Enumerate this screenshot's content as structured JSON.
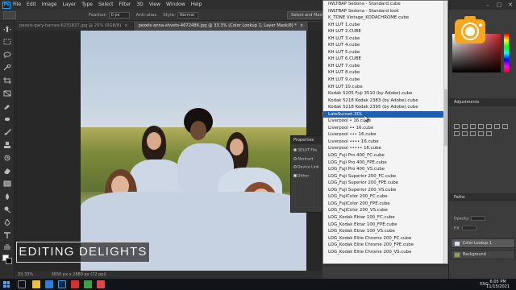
{
  "menubar": {
    "app_icon": "photoshop-logo",
    "items": [
      "File",
      "Edit",
      "Image",
      "Layer",
      "Type",
      "Select",
      "Filter",
      "3D",
      "View",
      "Window",
      "Help"
    ]
  },
  "options": {
    "feather_label": "Feather:",
    "feather_value": "0 px",
    "antialias_label": "Anti-alias",
    "style_label": "Style:",
    "style_value": "Normal",
    "select_mask_label": "Select and Mask..."
  },
  "tabs": [
    {
      "label": "pexels-gary-barnes-6231637.jpg @ 25% (RGB/8)",
      "close": "×"
    },
    {
      "label": "pexels-anna-shvets-4672486.jpg @ 33.3% (Color Lookup 1, Layer Mask/8) *",
      "close": "×"
    }
  ],
  "properties": {
    "title": "Properties",
    "row_file": "3DLUT File",
    "row_abstract": "Abstract",
    "row_device": "Device Link",
    "row_dither": "Dither"
  },
  "lut_list": {
    "items": [
      "IWLTBAP Sedona - Standard.cube",
      "IWLTBAP Sedona - Standard.look",
      "K_TONE Vintage_KODACHROME.cube",
      "KH LUT 1.cube",
      "KH LUT 2.CUBE",
      "KH LUT 3.cube",
      "KH LUT 4.cube",
      "KH LUT 5.cube",
      "KH LUT 6.CUBE",
      "KH LUT 7.cube",
      "KH LUT 8.cube",
      "KH LUT 9.cube",
      "KH LUT 10.cube",
      "Kodak 5205 Fuji 3510 (by Adobe).cube",
      "Kodak 5218 Kodak 2383 (by Adobe).cube",
      "Kodak 5218 Kodak 2395 (by Adobe).cube",
      "LateSunset.3DL",
      "Liverpool • 16.cube",
      "Liverpool •• 16.cube",
      "Liverpool ••• 16.cube",
      "Liverpool •••• 16.cube",
      "Liverpool ••••• 16.cube",
      "LOG_Fuji Pro 400_FC.cube",
      "LOG_Fuji Pro 400_FPE.cube",
      "LOG_Fuji Pro 400_VS.cube",
      "LOG_Fuji Superior 200_FC.cube",
      "LOG_Fuji Superior 200_FPE.cube",
      "LOG_Fuji Superior 200_VS.cube",
      "LOG_FujiColor 200_FC.cube",
      "LOG_FujiColor 200_FPE.cube",
      "LOG_FujiColor 200_VS.cube",
      "LOG_Kodak Ektar 100_FC.cube",
      "LOG_Kodak Ektar 100_FPE.cube",
      "LOG_Kodak Ektar 100_VS.cube",
      "LOG_Kodak Elite Chrome 200_FC.cube",
      "LOG_Kodak Elite Chrome 200_FPE.cube",
      "LOG_Kodak Elite Chrome 200_VS.cube"
    ],
    "selected_index": 16
  },
  "right_panel": {
    "adjustments_title": "Adjustments",
    "paths_title": "Paths",
    "opacity_label": "Opacity:",
    "fill_label": "Fill:",
    "layer_selected": "Color Lookup 1",
    "layer_base": "Background"
  },
  "status": {
    "zoom": "33.33%",
    "doc": "3650 px x 2880 px (72 ppi)"
  },
  "taskbar": {
    "tray_lang": "ENG",
    "time": "6:05 PM",
    "date": "11/15/2021"
  },
  "watermark": {
    "text": "EDITING DELIGHTS",
    "logo": "camera-icon"
  },
  "colors": {
    "selection": "#1c5fb3",
    "ps_blue": "#2fa3f2",
    "logo_orange": "#f6a71f"
  }
}
